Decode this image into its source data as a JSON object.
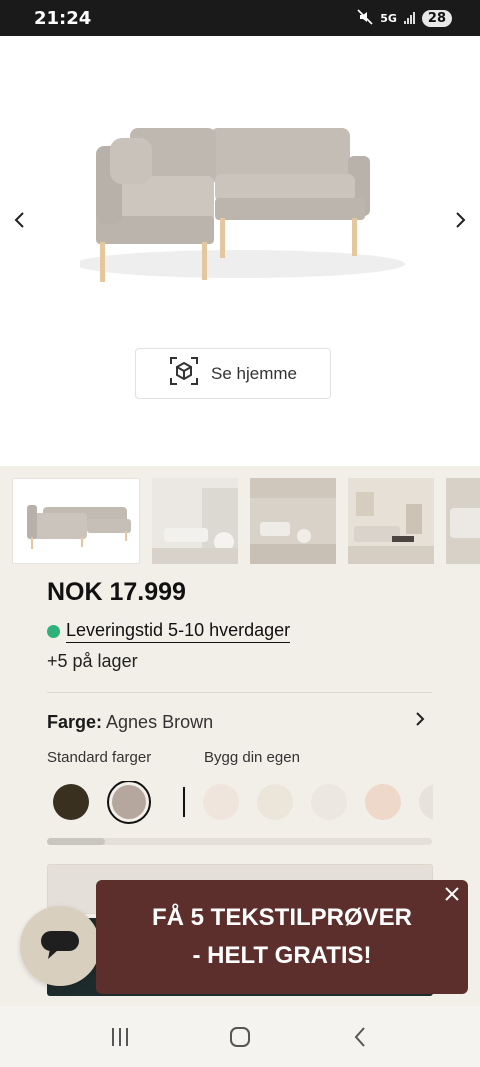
{
  "status": {
    "time": "21:24",
    "network": "5G",
    "battery": "28"
  },
  "hero": {
    "ar_button_label": "Se hjemme"
  },
  "product": {
    "price": "NOK 17.999",
    "delivery": "Leveringstid 5-10 hverdager",
    "stock": "+5  på lager",
    "color_key": "Farge:",
    "color_value": "Agnes Brown",
    "standard_colors_label": "Standard farger",
    "custom_colors_label": "Bygg din egen",
    "standard_swatches": [
      "#3a3020",
      "#b5a79e"
    ],
    "custom_swatches": [
      "#efe5dc",
      "#ece6da",
      "#ece7e1",
      "#eed8c9",
      "#e8e3da"
    ],
    "accent_green": "#2db37a"
  },
  "promo": {
    "line1": "FÅ 5 TEKSTILPRØVER",
    "line2": "- HELT GRATIS!",
    "background": "#5c2f2d"
  },
  "icons": {
    "prev": "chevron-left-icon",
    "next": "chevron-right-icon",
    "ar": "ar-cube-icon",
    "chat": "chat-bubble-icon",
    "close": "close-icon"
  }
}
